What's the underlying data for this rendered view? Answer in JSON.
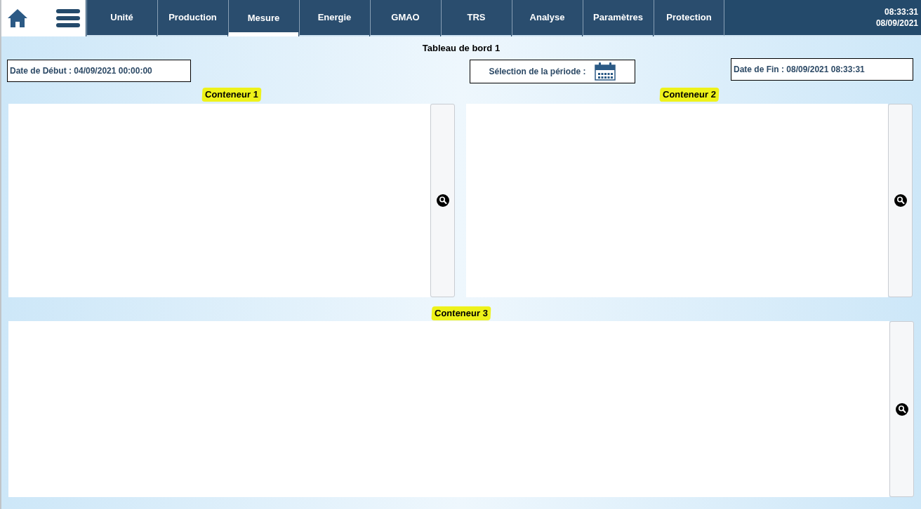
{
  "tabs": [
    {
      "label": "Unité",
      "selected": false
    },
    {
      "label": "Production",
      "selected": false
    },
    {
      "label": "Mesure",
      "selected": true
    },
    {
      "label": "Energie",
      "selected": false
    },
    {
      "label": "GMAO",
      "selected": false
    },
    {
      "label": "TRS",
      "selected": false
    },
    {
      "label": "Analyse",
      "selected": false
    },
    {
      "label": "Paramètres",
      "selected": false
    },
    {
      "label": "Protection",
      "selected": false
    }
  ],
  "clock": {
    "time": "08:33:31",
    "date": "08/09/2021"
  },
  "title": "Tableau de bord 1",
  "start_date": "Date de Début : 04/09/2021 00:00:00",
  "period_label": "Sélection de la période :",
  "end_date": "Date de Fin : 08/09/2021 08:33:31",
  "containers": [
    {
      "title": "Conteneur 1"
    },
    {
      "title": "Conteneur 2"
    },
    {
      "title": "Conteneur 3"
    }
  ]
}
